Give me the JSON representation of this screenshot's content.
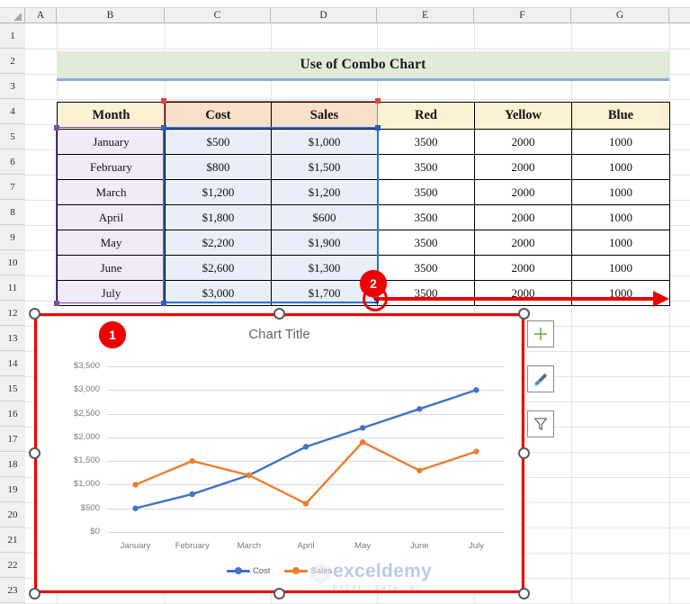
{
  "spreadsheet": {
    "column_headers": [
      "A",
      "B",
      "C",
      "D",
      "E",
      "F",
      "G"
    ],
    "row_headers": [
      "1",
      "2",
      "3",
      "4",
      "5",
      "6",
      "7",
      "8",
      "9",
      "10",
      "11",
      "12",
      "13",
      "14",
      "15",
      "16",
      "17",
      "18",
      "19",
      "20",
      "21",
      "22",
      "23"
    ],
    "title_banner": "Use of Combo Chart",
    "table": {
      "headers": [
        "Month",
        "Cost",
        "Sales",
        "Red",
        "Yellow",
        "Blue"
      ],
      "rows": [
        [
          "January",
          "$500",
          "$1,000",
          "3500",
          "2000",
          "1000"
        ],
        [
          "February",
          "$800",
          "$1,500",
          "3500",
          "2000",
          "1000"
        ],
        [
          "March",
          "$1,200",
          "$1,200",
          "3500",
          "2000",
          "1000"
        ],
        [
          "April",
          "$1,800",
          "$600",
          "3500",
          "2000",
          "1000"
        ],
        [
          "May",
          "$2,200",
          "$1,900",
          "3500",
          "2000",
          "1000"
        ],
        [
          "June",
          "$2,600",
          "$1,300",
          "3500",
          "2000",
          "1000"
        ],
        [
          "July",
          "$3,000",
          "$1,700",
          "3500",
          "2000",
          "1000"
        ]
      ]
    }
  },
  "annotations": {
    "badge_1": "1",
    "badge_2": "2"
  },
  "chart": {
    "title": "Chart Title",
    "side_buttons": [
      {
        "name": "chart-elements-button",
        "icon": "plus-icon"
      },
      {
        "name": "chart-styles-button",
        "icon": "paintbrush-icon"
      },
      {
        "name": "chart-filters-button",
        "icon": "funnel-icon"
      }
    ]
  },
  "watermark": {
    "main": "exceldemy",
    "sub": "EXCEL · DATA · BI"
  },
  "colors": {
    "cost_series": "#4472c4",
    "sales_series": "#ed7d31",
    "annotation_red": "#ee0000",
    "selection_blue": "#2a6fd4",
    "selection_purple": "#7b4fa8",
    "banner_green": "#e0ebd8",
    "header_cream": "#fdf1d4",
    "header_peach": "#fae0c8"
  },
  "chart_data": {
    "type": "line",
    "title": "Chart Title",
    "categories": [
      "January",
      "February",
      "March",
      "April",
      "May",
      "June",
      "July"
    ],
    "series": [
      {
        "name": "Cost",
        "values": [
          500,
          800,
          1200,
          1800,
          2200,
          2600,
          3000
        ],
        "color": "#4472c4"
      },
      {
        "name": "Sales",
        "values": [
          1000,
          1500,
          1200,
          600,
          1900,
          1300,
          1700
        ],
        "color": "#ed7d31"
      }
    ],
    "xlabel": "",
    "ylabel": "",
    "ylim": [
      0,
      3500
    ],
    "ytick_values": [
      0,
      500,
      1000,
      1500,
      2000,
      2500,
      3000,
      3500
    ],
    "ytick_labels": [
      "$0",
      "$500",
      "$1,000",
      "$1,500",
      "$2,000",
      "$2,500",
      "$3,000",
      "$3,500"
    ],
    "grid": true,
    "legend_position": "bottom"
  }
}
